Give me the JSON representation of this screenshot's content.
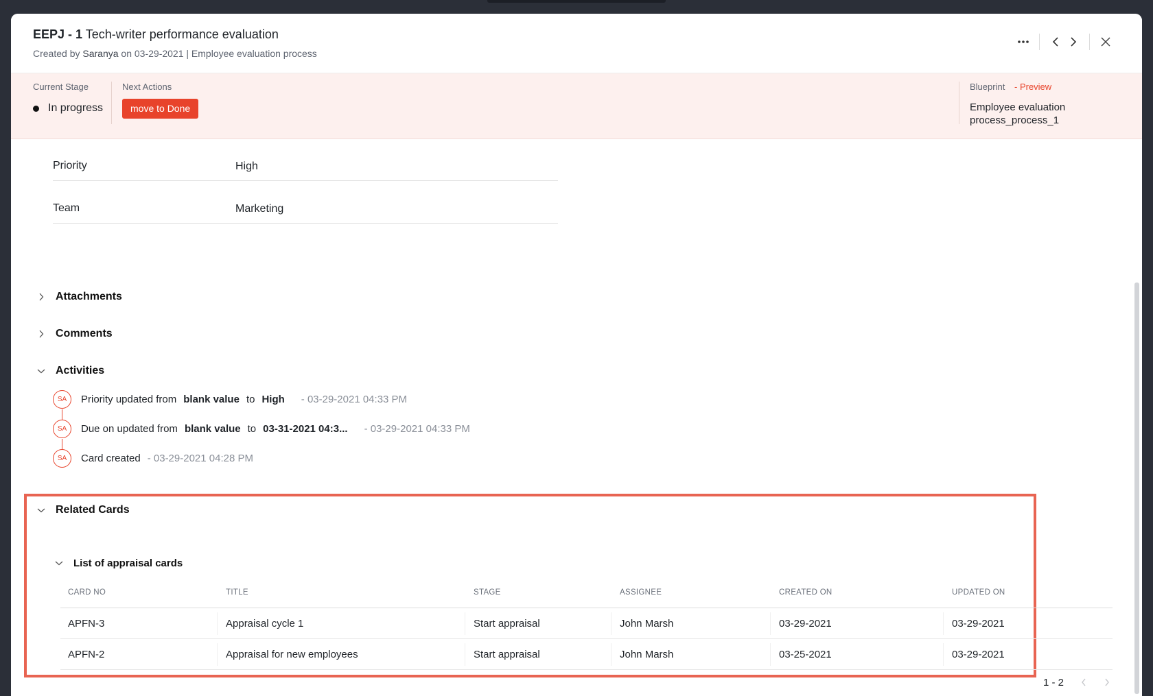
{
  "header": {
    "card_key": "EEPJ - 1",
    "card_title": "Tech-writer performance evaluation",
    "created_by_label": "Created by",
    "author": "Saranya",
    "created_on_text": "on 03-29-2021",
    "process_text": "| Employee evaluation process"
  },
  "stage_bar": {
    "current_stage_label": "Current Stage",
    "current_stage_value": "In progress",
    "next_actions_label": "Next Actions",
    "move_button_label": "move to Done",
    "blueprint_label": "Blueprint",
    "blueprint_preview_label": "- Preview",
    "blueprint_value": "Employee evaluation process_process_1"
  },
  "fields": [
    {
      "label": "Priority",
      "value": "High"
    },
    {
      "label": "Team",
      "value": "Marketing"
    }
  ],
  "sections": {
    "attachments": "Attachments",
    "comments": "Comments",
    "activities": "Activities",
    "related_cards": "Related Cards"
  },
  "activities": [
    {
      "avatar": "SA",
      "prefix": "Priority updated from",
      "from": "blank value",
      "to_word": "to",
      "to": "High",
      "time": "- 03-29-2021 04:33 PM"
    },
    {
      "avatar": "SA",
      "prefix": "Due on updated from",
      "from": "blank value",
      "to_word": "to",
      "to": "03-31-2021 04:3...",
      "time": "- 03-29-2021 04:33 PM"
    },
    {
      "avatar": "SA",
      "text": "Card created",
      "time": "- 03-29-2021 04:28 PM"
    }
  ],
  "related": {
    "list_title": "List of appraisal cards",
    "columns": [
      "CARD NO",
      "TITLE",
      "STAGE",
      "ASSIGNEE",
      "CREATED ON",
      "UPDATED ON"
    ],
    "rows": [
      [
        "APFN-3",
        "Appraisal cycle 1",
        "Start appraisal",
        "John Marsh",
        "03-29-2021",
        "03-29-2021"
      ],
      [
        "APFN-2",
        "Appraisal for new employees",
        "Start appraisal",
        "John Marsh",
        "03-25-2021",
        "03-29-2021"
      ]
    ],
    "pagination": "1 - 2"
  },
  "icons": {
    "more": "more-options-icon",
    "prev": "chevron-left-icon",
    "next": "chevron-right-icon",
    "close": "close-icon",
    "collapsed": "chevron-right-icon",
    "expanded": "chevron-down-icon"
  },
  "colors": {
    "accent": "#e8432b",
    "stage_bar_bg": "#fdf0ee",
    "highlight_border": "#e86452"
  }
}
